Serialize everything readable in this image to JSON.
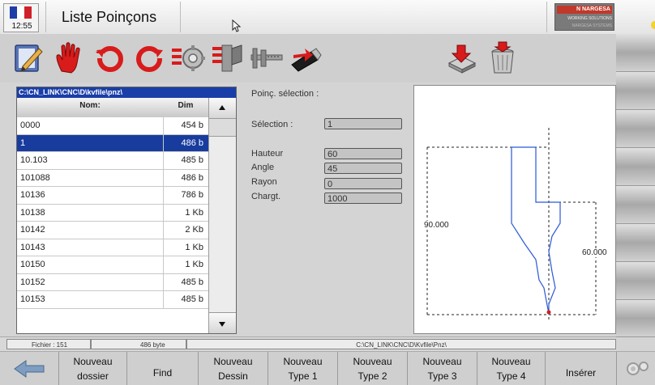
{
  "header": {
    "clock": "12:55",
    "title": "Liste Poinçons",
    "flag_colors": [
      "#1f3fa6",
      "#ffffff",
      "#d0202a"
    ],
    "logo": {
      "brand": "N NARGESA",
      "tagline": "WORKING SOLUTIONS",
      "subline": "NARGESA SYSTEMS"
    }
  },
  "toolbar": {
    "icons": [
      "edit-icon",
      "stop-hand-icon",
      "rotate-left-icon",
      "rotate-right-icon",
      "settings-icon",
      "tool-icon",
      "caliper-icon",
      "usb-drive-icon",
      "download-disk-icon",
      "trash-icon"
    ]
  },
  "list": {
    "path": "C:\\CN_LINK\\CNC\\D\\kvfile\\pnz\\",
    "col_nom": "Nom:",
    "col_dim": "Dim",
    "rows": [
      {
        "nom": "0000",
        "dim": "454 b"
      },
      {
        "nom": "1",
        "dim": "486 b",
        "selected": true
      },
      {
        "nom": "10.103",
        "dim": "485 b"
      },
      {
        "nom": "101088",
        "dim": "486 b"
      },
      {
        "nom": "10136",
        "dim": "786 b"
      },
      {
        "nom": "10138",
        "dim": "1 Kb"
      },
      {
        "nom": "10142",
        "dim": "2 Kb"
      },
      {
        "nom": "10143",
        "dim": "1 Kb"
      },
      {
        "nom": "10150",
        "dim": "1 Kb"
      },
      {
        "nom": "10152",
        "dim": "485 b"
      },
      {
        "nom": "10153",
        "dim": "485 b"
      }
    ]
  },
  "form": {
    "section_title": "Poinç. sélection :",
    "selection_label": "Sélection :",
    "selection_value": "1",
    "hauteur_label": "Hauteur",
    "hauteur_value": "60",
    "angle_label": "Angle",
    "angle_value": "45",
    "rayon_label": "Rayon",
    "rayon_value": "0",
    "chargt_label": "Chargt.",
    "chargt_value": "1000"
  },
  "drawing": {
    "width_label": "90.000",
    "height_label": "60.000"
  },
  "status": {
    "fichier": "Fichier : 151",
    "size": "486 byte",
    "path": "C:\\CN_LINK\\CNC\\D\\Kvfile\\Pnz\\"
  },
  "bottom": {
    "buttons": [
      {
        "line1": "Nouveau",
        "line2": "dossier"
      },
      {
        "line1": "Find",
        "line2": ""
      },
      {
        "line1": "Nouveau",
        "line2": "Dessin"
      },
      {
        "line1": "Nouveau",
        "line2": "Type 1"
      },
      {
        "line1": "Nouveau",
        "line2": "Type 2"
      },
      {
        "line1": "Nouveau",
        "line2": "Type 3"
      },
      {
        "line1": "Nouveau",
        "line2": "Type 4"
      },
      {
        "line1": "Insérer",
        "line2": ""
      }
    ]
  }
}
